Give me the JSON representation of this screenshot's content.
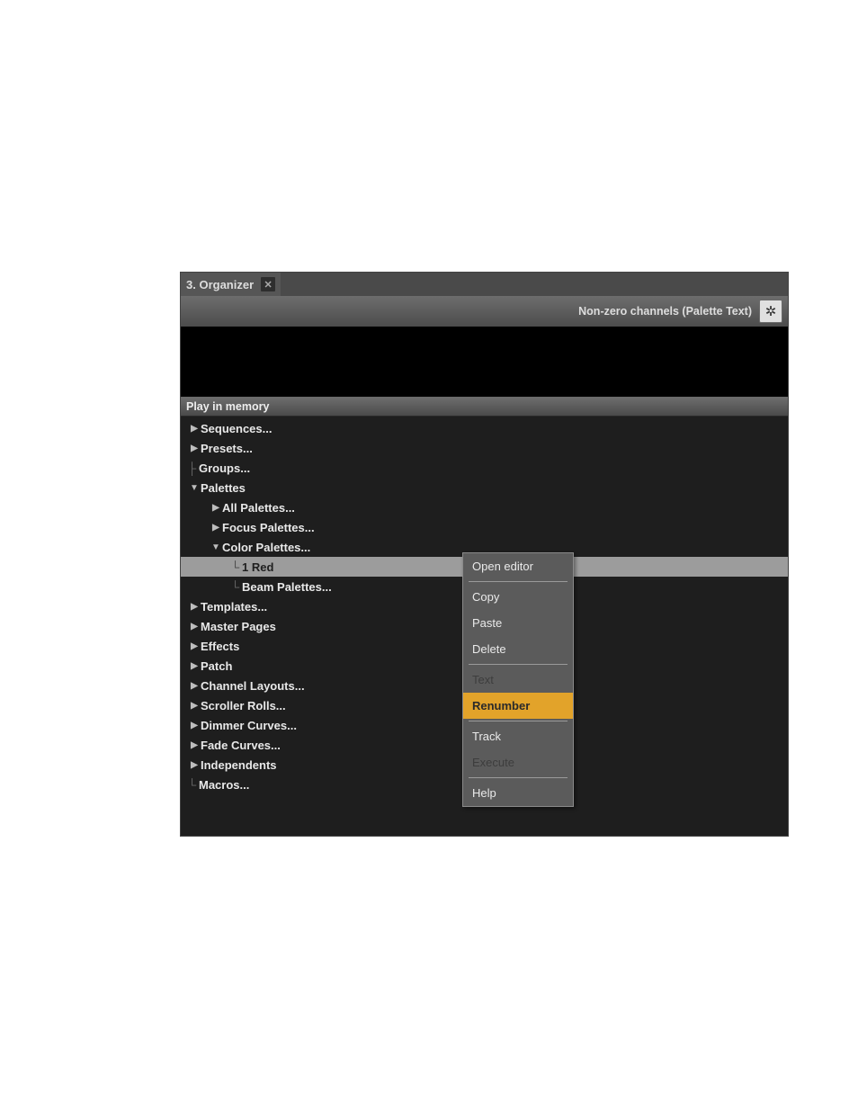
{
  "tab": {
    "title": "3. Organizer"
  },
  "toolbar": {
    "status": "Non-zero channels (Palette Text)"
  },
  "section": {
    "title": "Play in memory"
  },
  "tree": {
    "sequences": "Sequences...",
    "presets": "Presets...",
    "groups": "Groups...",
    "palettes": "Palettes",
    "all_palettes": "All Palettes...",
    "focus_palettes": "Focus Palettes...",
    "color_palettes": "Color Palettes...",
    "color_red": "1 Red",
    "beam_palettes": "Beam Palettes...",
    "templates": "Templates...",
    "master_pages": "Master Pages",
    "effects": "Effects",
    "patch": "Patch",
    "channel_layouts": "Channel Layouts...",
    "scroller_rolls": "Scroller Rolls...",
    "dimmer_curves": "Dimmer Curves...",
    "fade_curves": "Fade Curves...",
    "independents": "Independents",
    "macros": "Macros..."
  },
  "context_menu": {
    "open_editor": "Open editor",
    "copy": "Copy",
    "paste": "Paste",
    "delete": "Delete",
    "text": "Text",
    "renumber": "Renumber",
    "track": "Track",
    "execute": "Execute",
    "help": "Help"
  }
}
